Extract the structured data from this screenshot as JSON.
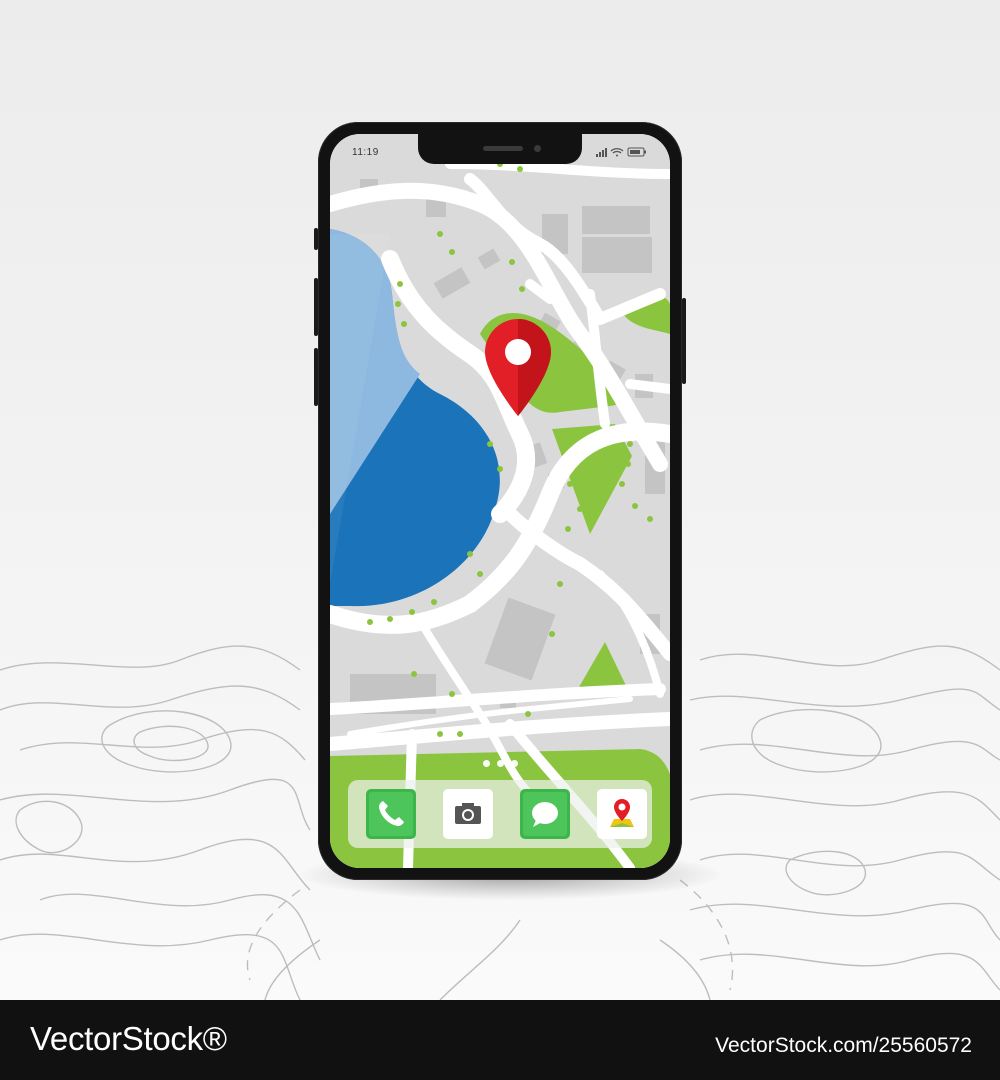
{
  "status_bar": {
    "time": "11:19"
  },
  "map": {
    "water_color": "#1b73b9",
    "park_color": "#8bc53f",
    "road_color": "#ffffff",
    "block_color": "#c4c4c4",
    "pin_color": "#e21e26"
  },
  "dock": {
    "apps": [
      {
        "name": "phone-app",
        "icon": "phone-icon",
        "color": "#3cb54a"
      },
      {
        "name": "camera-app",
        "icon": "camera-icon",
        "color": "#ffffff"
      },
      {
        "name": "messages-app",
        "icon": "chat-bubble-icon",
        "color": "#3cb54a"
      },
      {
        "name": "maps-app",
        "icon": "map-pin-icon",
        "color": "#ffffff"
      }
    ]
  },
  "watermark": {
    "brand": "VectorStock®",
    "id": "VectorStock.com/25560572"
  }
}
